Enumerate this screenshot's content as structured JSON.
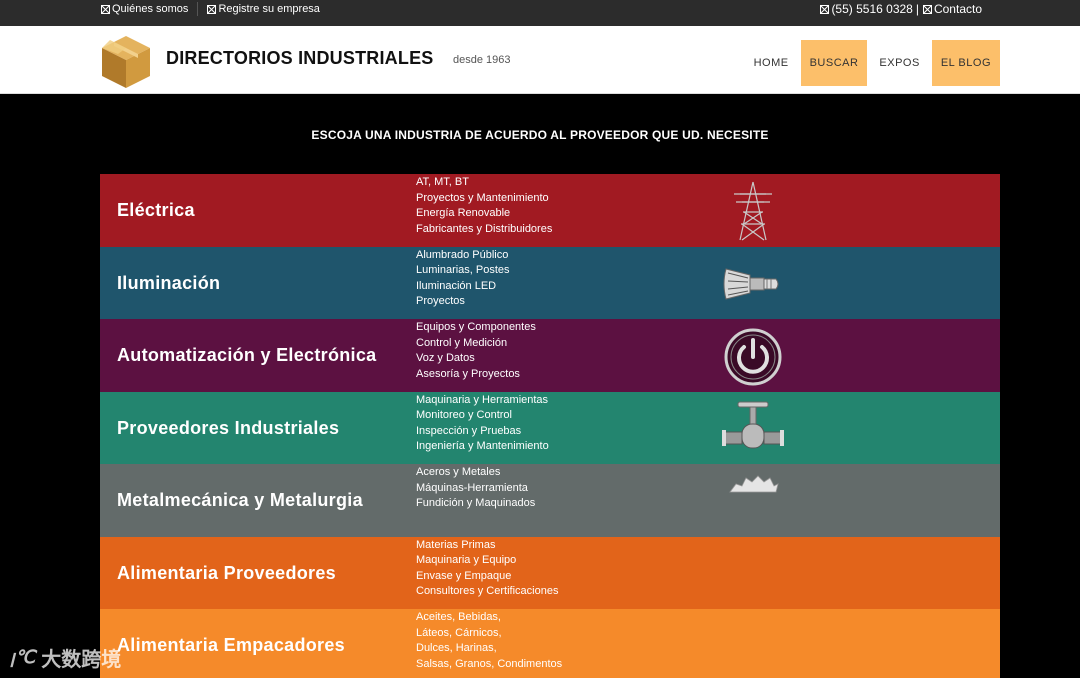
{
  "topbar": {
    "links": [
      "Quiénes somos",
      "Registre su empresa"
    ],
    "phone": "(55) 5516 0328",
    "separator": "|",
    "contact": "Contacto"
  },
  "header": {
    "brand": "DIRECTORIOS INDUSTRIALES",
    "since": "desde 1963",
    "nav": [
      {
        "label": "HOME",
        "highlight": false
      },
      {
        "label": "BUSCAR",
        "highlight": true
      },
      {
        "label": "EXPOS",
        "highlight": false
      },
      {
        "label": "EL BLOG",
        "highlight": true
      }
    ],
    "highlight_color": "#fcbf6a"
  },
  "intro": "ESCOJA UNA INDUSTRIA DE ACUERDO AL PROVEEDOR QUE UD. NECESITE",
  "categories": [
    {
      "title": "Eléctrica",
      "color": "#a11a22",
      "icon": "power-tower-icon",
      "items": [
        "AT, MT, BT",
        "Proyectos y Mantenimiento",
        "Energía Renovable",
        "Fabricantes y Distribuidores"
      ]
    },
    {
      "title": "Iluminación",
      "color": "#1f556c",
      "icon": "light-bulb-icon",
      "items": [
        "Alumbrado Público",
        "Luminarias, Postes",
        "Iluminación LED",
        "Proyectos"
      ]
    },
    {
      "title": "Automatización y Electrónica",
      "color": "#5c1141",
      "icon": "power-button-icon",
      "items": [
        "Equipos y Componentes",
        "Control y Medición",
        "Voz y Datos",
        "Asesoría y Proyectos"
      ]
    },
    {
      "title": "Proveedores Industriales",
      "color": "#23856f",
      "icon": "valve-icon",
      "items": [
        "Maquinaria y Herramientas",
        "Monitoreo y Control",
        "Inspección y Pruebas",
        "Ingeniería y Mantenimiento"
      ]
    },
    {
      "title": "Metalmecánica y Metalurgia",
      "color": "#636b6a",
      "icon": "gears-icon",
      "items": [
        "Aceros y Metales",
        "Máquinas-Herramienta",
        "Fundición y Maquinados"
      ]
    },
    {
      "title": "Alimentaria Proveedores",
      "color": "#e2641a",
      "icon": "",
      "items": [
        "Materias Primas",
        "Maquinaria y Equipo",
        "Envase y Empaque",
        "Consultores y Certificaciones"
      ]
    },
    {
      "title": "Alimentaria Empacadores",
      "color": "#f58a2a",
      "icon": "",
      "items": [
        "Aceites, Bebidas,",
        "Láteos, Cárnicos,",
        "Dulces, Harinas,",
        "Salsas, Granos, Condimentos"
      ]
    }
  ],
  "watermark": {
    "mark": "ꞁ℃",
    "text": "大数跨境"
  }
}
